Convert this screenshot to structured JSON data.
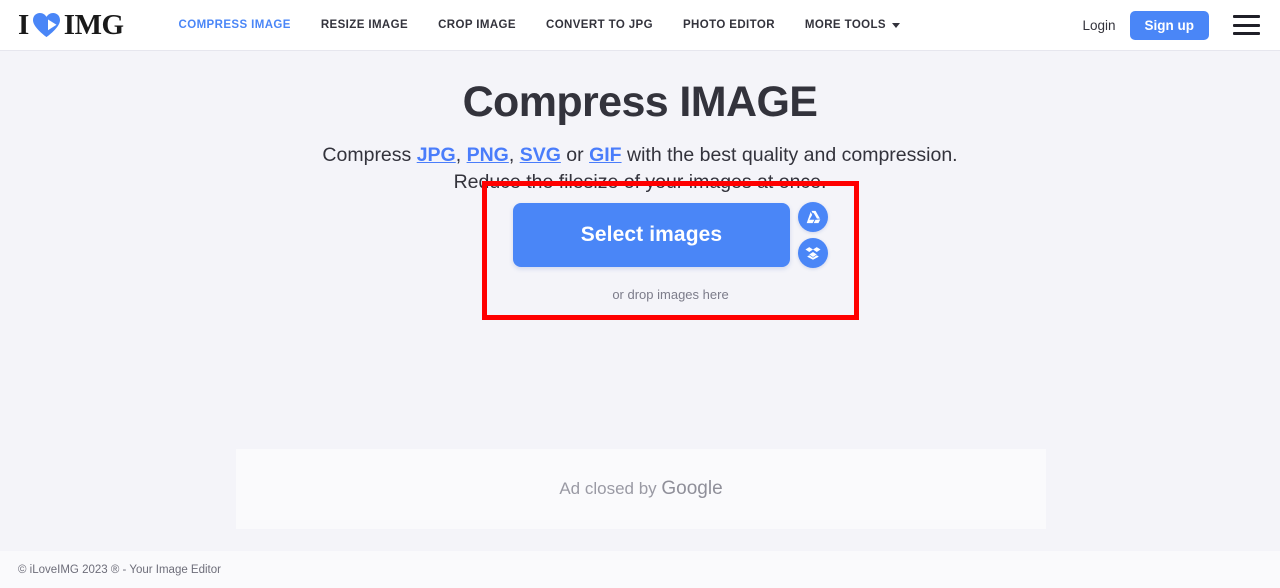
{
  "header": {
    "logo": {
      "text_left": "I",
      "icon": "heart-icon",
      "text_right": "IMG",
      "heart_color": "#4a86f7"
    },
    "nav_items": [
      {
        "label": "COMPRESS IMAGE",
        "active": true
      },
      {
        "label": "RESIZE IMAGE",
        "active": false
      },
      {
        "label": "CROP IMAGE",
        "active": false
      },
      {
        "label": "CONVERT TO JPG",
        "active": false
      },
      {
        "label": "PHOTO EDITOR",
        "active": false
      },
      {
        "label": "MORE TOOLS",
        "active": false,
        "caret": true
      }
    ],
    "login_label": "Login",
    "signup_label": "Sign up",
    "menu_icon": "hamburger-icon",
    "accent_color": "#4a86f7"
  },
  "main": {
    "title": "Compress IMAGE",
    "subtitle_part1": "Compress ",
    "subtitle_links": [
      "JPG",
      "PNG",
      "SVG",
      "GIF"
    ],
    "subtitle_sep1": ", ",
    "subtitle_sep2": ", ",
    "subtitle_sep3": " or ",
    "subtitle_part2": " with the best quality and compression.",
    "subtitle_line2": "Reduce the filesize of your images at once.",
    "select_button_label": "Select images",
    "drop_text": "or drop images here",
    "cloud_buttons": [
      {
        "name": "google-drive-icon",
        "label": "Google Drive"
      },
      {
        "name": "dropbox-icon",
        "label": "Dropbox"
      }
    ],
    "highlight_color": "#ff0000"
  },
  "ad": {
    "text_prefix": "Ad closed by ",
    "brand": "Google"
  },
  "footer": {
    "text": "© iLoveIMG 2023 ® - Your Image Editor"
  }
}
